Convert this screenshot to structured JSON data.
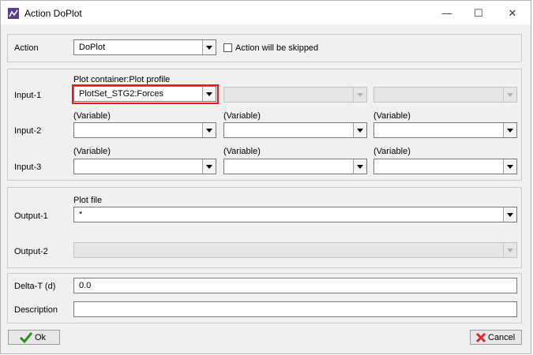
{
  "window": {
    "title": "Action DoPlot",
    "minimize_glyph": "—",
    "maximize_glyph": "☐",
    "close_glyph": "✕"
  },
  "action": {
    "label": "Action",
    "value": "DoPlot",
    "skip_label": "Action will be skipped",
    "skip_checked": false
  },
  "inputs": {
    "header_label": "Plot container:Plot profile",
    "variable_label": "(Variable)",
    "rows": [
      {
        "label": "Input-1",
        "col1": "PlotSet_STG2:Forces",
        "col2": "",
        "col3": ""
      },
      {
        "label": "Input-2",
        "col1": "",
        "col2": "",
        "col3": ""
      },
      {
        "label": "Input-3",
        "col1": "",
        "col2": "",
        "col3": ""
      }
    ]
  },
  "outputs": {
    "plot_file_label": "Plot file",
    "rows": [
      {
        "label": "Output-1",
        "value": "*"
      },
      {
        "label": "Output-2",
        "value": ""
      }
    ]
  },
  "params": {
    "delta_label": "Delta-T (d)",
    "delta_value": "0.0",
    "description_label": "Description",
    "description_value": ""
  },
  "buttons": {
    "ok_label": "Ok",
    "cancel_label": "Cancel"
  },
  "colors": {
    "highlight": "#e31b1b",
    "ok_check": "#2e8b22",
    "cancel_x": "#d9262b"
  }
}
